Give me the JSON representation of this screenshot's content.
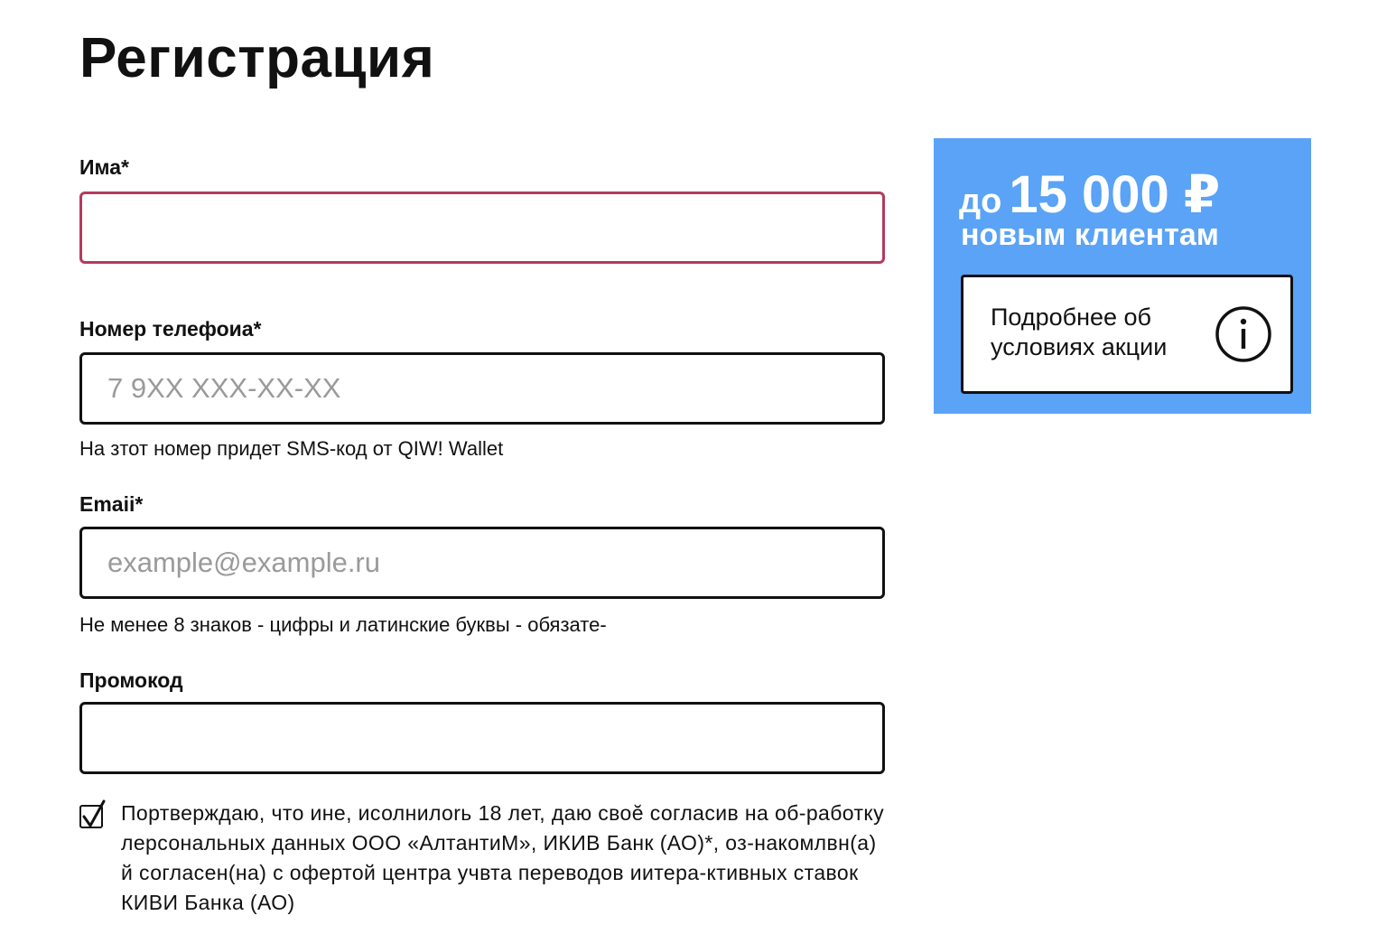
{
  "page": {
    "title": "Регистрация"
  },
  "form": {
    "name_label": "Има*",
    "name_value": "",
    "name_placeholder": "",
    "phone_label": "Номер телефоиа*",
    "phone_value": "",
    "phone_placeholder": "7 9XX XXX-XX-XX",
    "phone_hint": "На зтот номер придет SMS-код от QIW! Wallet",
    "email_label": "Emaii*",
    "email_value": "",
    "email_placeholder": "example@example.ru",
    "email_hint": "Не менее 8 знаков - цифры и латинские буквы - обязате-",
    "promo_label": "Промокод",
    "promo_value": "",
    "promo_placeholder": "",
    "consent_checked": true,
    "consent_text": "Портверждаю, что ине, исолнилоrь 18 лет, даю своӗ согласив на об-работку лерсональных данных ООО «АлтантиМ», ИКИВ Банк (АО)*, оз-накомлвн(а) й согласен(на) с офертой центра учвта переводов иитера-ктивных ставок КИВИ Банка (АО)"
  },
  "promo": {
    "prefix": "до",
    "amount": "15 000 ₽",
    "subtitle": "новым клиентам",
    "details_label": "Подробнее об условиях акции",
    "icon": "info-icon",
    "background_color": "#5aa3f6"
  },
  "colors": {
    "invalid_border": "#b53a5d",
    "border": "#111111",
    "placeholder": "#9a9a9a"
  }
}
